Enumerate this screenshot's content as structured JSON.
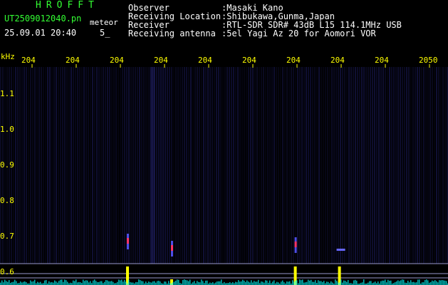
{
  "header": {
    "app_title": "HROFFT",
    "file_name": "UT2509012040.pn",
    "meteor_label": "meteor",
    "datetime": "25.09.01 20:40",
    "count": "5_"
  },
  "info": [
    {
      "label": "Observer",
      "value": ":Masaki Kano"
    },
    {
      "label": "Receiving Location",
      "value": ":Shibukawa,Gunma,Japan"
    },
    {
      "label": "Receiver",
      "value": ":RTL-SDR SDR# 43dB L15 114.1MHz USB"
    },
    {
      "label": "Receiving antenna",
      "value": ":5el Yagi Az 20 for Aomori VOR"
    }
  ],
  "axis": {
    "unit": "kHz",
    "time_ticks": [
      "204",
      "204",
      "204",
      "204",
      "204",
      "204",
      "204",
      "204",
      "204",
      "2050"
    ],
    "freq_ticks": [
      "1.1",
      "1.0",
      "0.9",
      "0.8",
      "0.7",
      "0.6"
    ]
  },
  "colors": {
    "background": "#000000",
    "title_green": "#33ff33",
    "axis_yellow": "#ffff00",
    "noise_blue": "#1a1a5a",
    "echo_signal": "#ff3366",
    "power_cyan": "#00ffff"
  },
  "chart_data": {
    "type": "heatmap",
    "x_ticks": [
      "204",
      "204",
      "204",
      "204",
      "204",
      "204",
      "204",
      "204",
      "204",
      "2050"
    ],
    "y_ticks": [
      1.1,
      1.0,
      0.9,
      0.8,
      0.7,
      0.6
    ],
    "ylabel": "kHz",
    "ylim": [
      0.6,
      1.1
    ],
    "echoes": [
      {
        "time_index": 2.0,
        "freq": 0.68
      },
      {
        "time_index": 3.0,
        "freq": 0.66
      },
      {
        "time_index": 5.8,
        "freq": 0.67
      },
      {
        "time_index": 6.8,
        "freq": 0.66
      }
    ]
  }
}
